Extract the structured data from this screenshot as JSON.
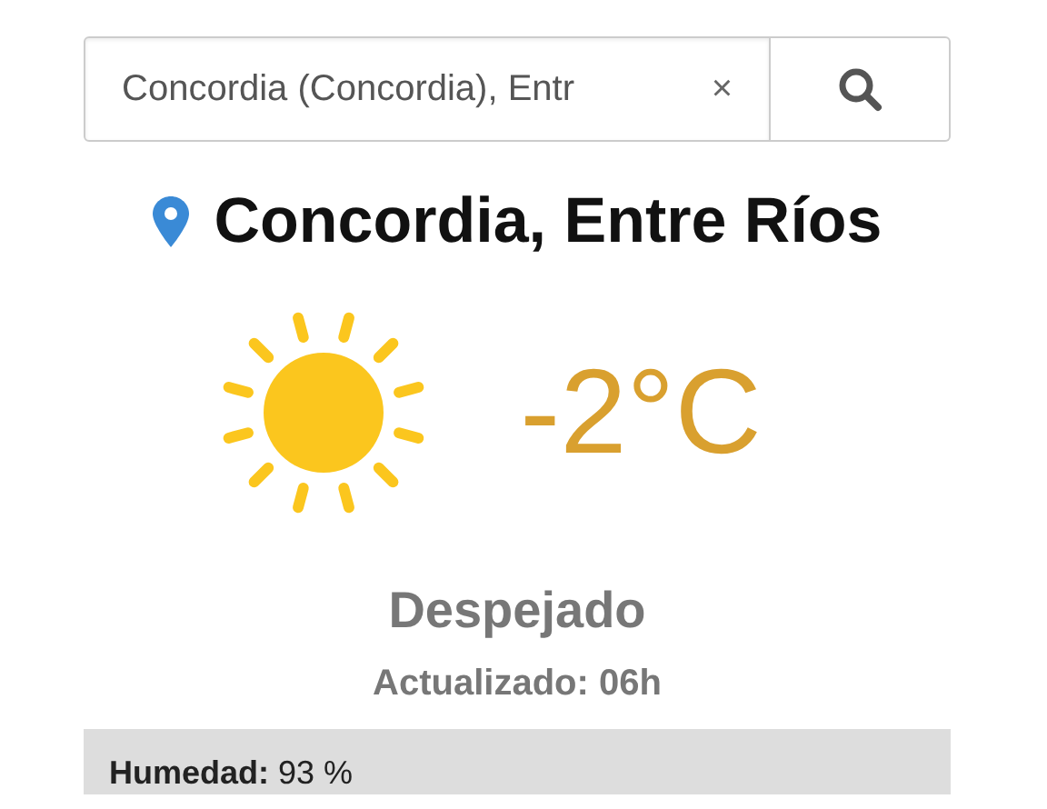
{
  "search": {
    "value": "Concordia (Concordia), Entr",
    "clear": "×"
  },
  "location": "Concordia, Entre Ríos",
  "temperature": "-2°C",
  "condition": "Despejado",
  "updated": "Actualizado: 06h",
  "details": [
    "**Humedad:** 93 %"
  ]
}
